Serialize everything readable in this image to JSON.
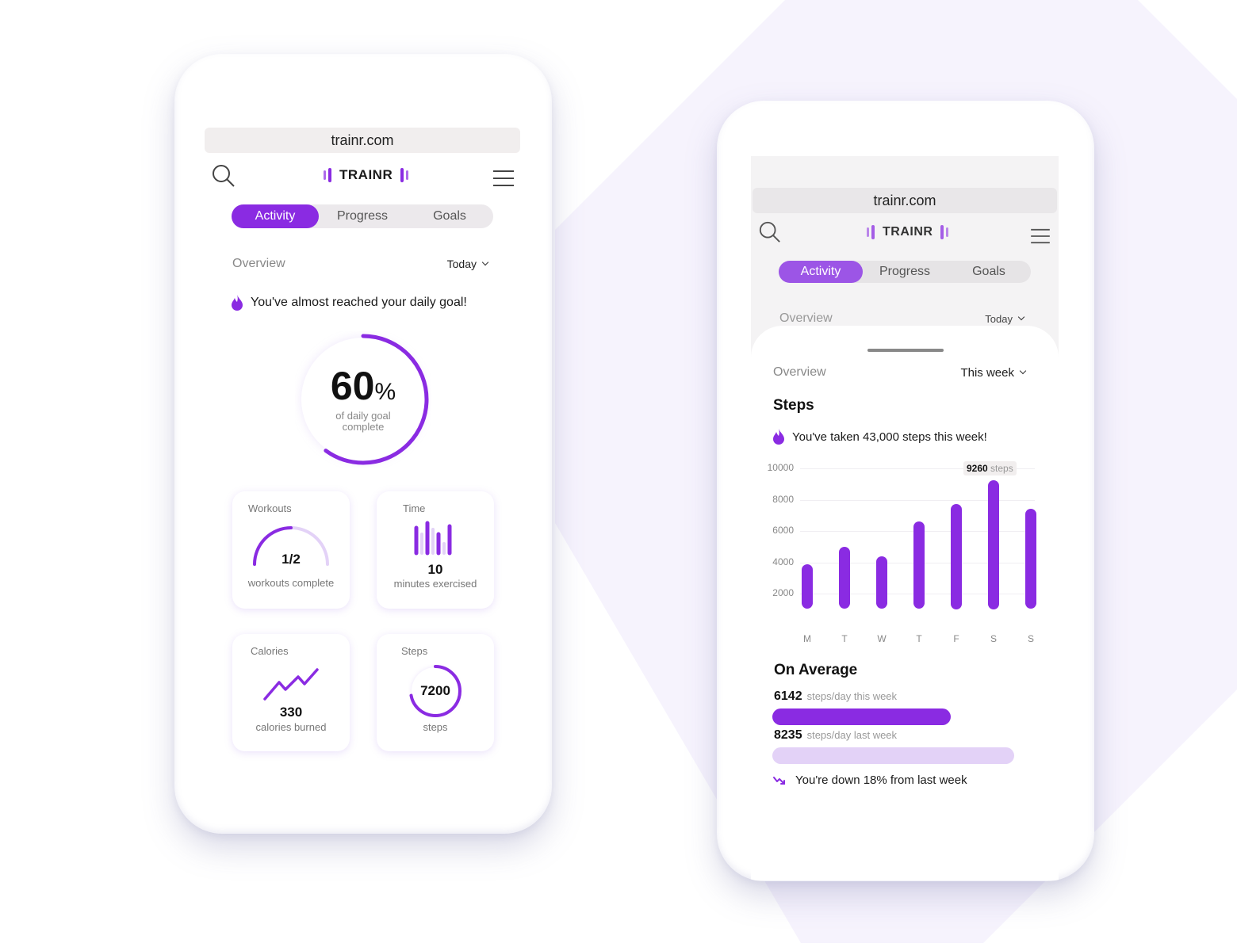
{
  "colors": {
    "accent": "#8a2be2",
    "accent_light": "#e3d2f7",
    "background_shape": "#f6f3fd",
    "url_bar": "#f1eeee"
  },
  "left_phone": {
    "url": "trainr.com",
    "brand": "TRAINR",
    "icons": {
      "search": "search-icon",
      "menu": "hamburger-menu-icon",
      "flame": "flame-icon"
    },
    "tabs": [
      {
        "label": "Activity",
        "active": true
      },
      {
        "label": "Progress",
        "active": false
      },
      {
        "label": "Goals",
        "active": false
      }
    ],
    "overview_label": "Overview",
    "range_selector": "Today",
    "message": "You've almost reached your daily goal!",
    "daily_goal": {
      "percent": 60,
      "value_label": "60",
      "unit": "%",
      "caption_line1": "of daily goal",
      "caption_line2": "complete"
    },
    "cards": {
      "workouts": {
        "title": "Workouts",
        "value": "1/2",
        "caption": "workouts complete",
        "progress": 0.5
      },
      "time": {
        "title": "Time",
        "value": "10",
        "caption": "minutes exercised"
      },
      "calories": {
        "title": "Calories",
        "value": "330",
        "caption": "calories burned"
      },
      "steps": {
        "title": "Steps",
        "value": "7200",
        "caption": "steps",
        "progress": 0.72
      }
    }
  },
  "right_phone": {
    "url": "trainr.com",
    "brand": "TRAINR",
    "tabs": [
      {
        "label": "Activity",
        "active": true
      },
      {
        "label": "Progress",
        "active": false
      },
      {
        "label": "Goals",
        "active": false
      }
    ],
    "background_overview_label": "Overview",
    "background_range_selector": "Today",
    "sheet": {
      "overview_label": "Overview",
      "range_selector": "This week",
      "section_title": "Steps",
      "message": "You've taken 43,000 steps this week!",
      "tooltip_value": "9260",
      "tooltip_unit": "steps",
      "average": {
        "title": "On Average",
        "this_week_value": "6142",
        "this_week_label": "steps/day this week",
        "last_week_value": "8235",
        "last_week_label": "steps/day last week",
        "trend_message": "You're down 18% from last week"
      }
    }
  },
  "chart_data": {
    "type": "bar",
    "title": "Steps",
    "categories": [
      "M",
      "T",
      "W",
      "T",
      "F",
      "S",
      "S"
    ],
    "values": [
      3900,
      5000,
      4400,
      6600,
      7750,
      9260,
      7400
    ],
    "y_ticks": [
      2000,
      4000,
      6000,
      8000,
      10000
    ],
    "ylim": [
      0,
      10000
    ],
    "grid": true,
    "highlight": {
      "index": 5,
      "label": "9260 steps"
    },
    "xlabel": "",
    "ylabel": ""
  }
}
